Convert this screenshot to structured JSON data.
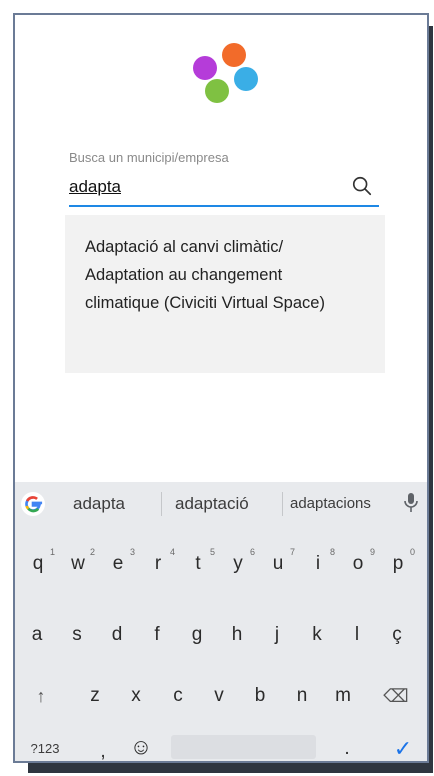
{
  "search": {
    "label": "Busca un municipi/empresa",
    "value": "adapta"
  },
  "suggestion": {
    "text": "Adaptació al canvi climàtic/ Adaptation au changement climatique (Civiciti Virtual Space)"
  },
  "keyboard": {
    "suggestions": [
      "adapta",
      "adaptació",
      "adaptacions"
    ],
    "row1": [
      {
        "k": "q",
        "n": "1"
      },
      {
        "k": "w",
        "n": "2"
      },
      {
        "k": "e",
        "n": "3"
      },
      {
        "k": "r",
        "n": "4"
      },
      {
        "k": "t",
        "n": "5"
      },
      {
        "k": "y",
        "n": "6"
      },
      {
        "k": "u",
        "n": "7"
      },
      {
        "k": "i",
        "n": "8"
      },
      {
        "k": "o",
        "n": "9"
      },
      {
        "k": "p",
        "n": "0"
      }
    ],
    "row2": [
      "a",
      "s",
      "d",
      "f",
      "g",
      "h",
      "j",
      "k",
      "l",
      "ç"
    ],
    "row3": [
      "↑",
      "z",
      "x",
      "c",
      "v",
      "b",
      "n",
      "m",
      "⌫"
    ],
    "row4": {
      "sym": "?123",
      "comma": ",",
      "emoji": "☺",
      "period": ".",
      "enter": "✓"
    }
  },
  "colors": {
    "accent": "#1e88e5",
    "logo_orange": "#f26b2a",
    "logo_purple": "#b53cd9",
    "logo_blue": "#3aaee6",
    "logo_green": "#7fc142"
  }
}
